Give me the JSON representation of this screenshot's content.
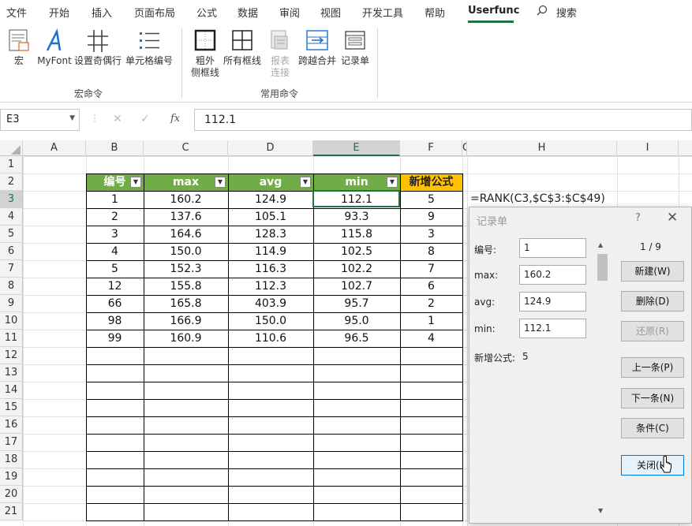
{
  "menu": {
    "items": [
      "文件",
      "开始",
      "插入",
      "页面布局",
      "公式",
      "数据",
      "审阅",
      "视图",
      "开发工具",
      "帮助",
      "Userfunc"
    ],
    "search_label": "搜索"
  },
  "ribbon": {
    "group1": {
      "buttons": [
        "宏",
        "MyFont",
        "设置奇偶行",
        "单元格编号"
      ],
      "label": "宏命令"
    },
    "group2": {
      "buttons": [
        {
          "line1": "粗外",
          "line2": "侧框线"
        },
        {
          "line1": "所有框线",
          "line2": ""
        },
        {
          "line1": "报表",
          "line2": "连接"
        },
        {
          "line1": "跨越合并",
          "line2": ""
        },
        {
          "line1": "记录单",
          "line2": ""
        }
      ],
      "label": "常用命令"
    }
  },
  "formula_bar": {
    "name_box": "E3",
    "cancel": "✕",
    "enter": "✓",
    "fx": "fx",
    "value": "112.1"
  },
  "sheet": {
    "columns": [
      "A",
      "B",
      "C",
      "D",
      "E",
      "F",
      "G",
      "H",
      "I"
    ],
    "rows": [
      "1",
      "2",
      "3",
      "4",
      "5",
      "6",
      "7",
      "8",
      "9",
      "10",
      "11",
      "12",
      "13",
      "14",
      "15",
      "16",
      "17",
      "18",
      "19",
      "20",
      "21"
    ],
    "table_headers": [
      "编号",
      "max",
      "avg",
      "min",
      "新增公式"
    ],
    "table_rows": [
      [
        "1",
        "160.2",
        "124.9",
        "112.1",
        "5"
      ],
      [
        "2",
        "137.6",
        "105.1",
        "93.3",
        "9"
      ],
      [
        "3",
        "164.6",
        "128.3",
        "115.8",
        "3"
      ],
      [
        "4",
        "150.0",
        "114.9",
        "102.5",
        "8"
      ],
      [
        "5",
        "152.3",
        "116.3",
        "102.2",
        "7"
      ],
      [
        "12",
        "155.8",
        "112.3",
        "102.7",
        "6"
      ],
      [
        "66",
        "165.8",
        "403.9",
        "95.7",
        "2"
      ],
      [
        "98",
        "166.9",
        "150.0",
        "95.0",
        "1"
      ],
      [
        "99",
        "160.9",
        "110.6",
        "96.5",
        "4"
      ]
    ],
    "formula_note": "=RANK(C3,$C$3:$C$49)",
    "selected_cell": "E3"
  },
  "dialog": {
    "title": "记录单",
    "help": "?",
    "close": "✕",
    "record_counter": "1 / 9",
    "fields": [
      {
        "label": "编号:",
        "value": "1"
      },
      {
        "label": "max:",
        "value": "160.2"
      },
      {
        "label": "avg:",
        "value": "124.9"
      },
      {
        "label": "min:",
        "value": "112.1"
      }
    ],
    "computed": {
      "label": "新增公式:",
      "value": "5"
    },
    "buttons": [
      "新建(W)",
      "删除(D)",
      "还原(R)",
      "上一条(P)",
      "下一条(N)",
      "条件(C)",
      "关闭(L)"
    ],
    "disabled_buttons": [
      "还原(R)"
    ]
  },
  "colors": {
    "header_green": "#70ad47",
    "header_gold": "#ffc000",
    "excel_green": "#217346"
  }
}
